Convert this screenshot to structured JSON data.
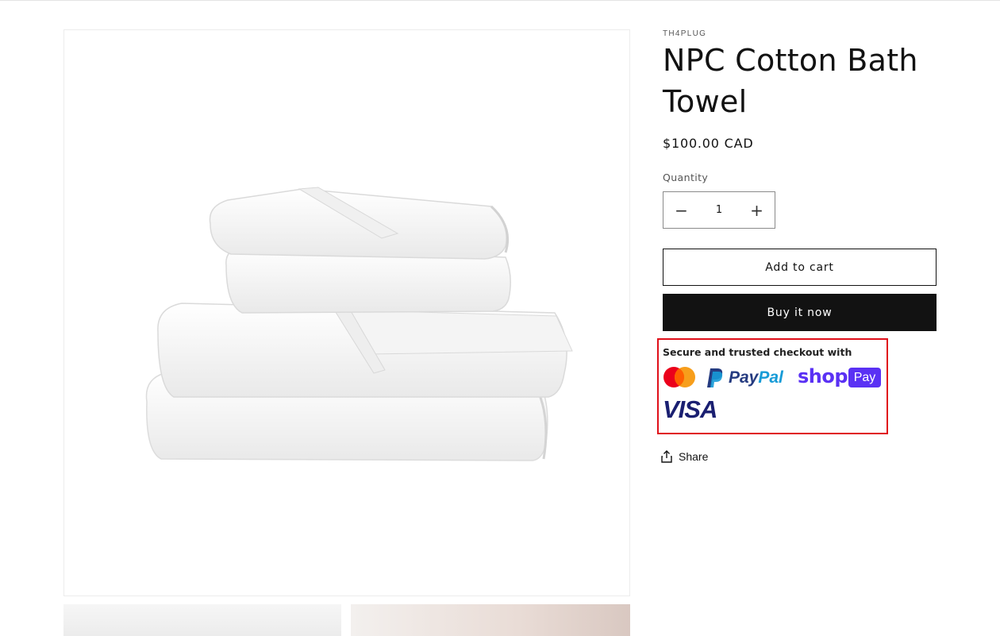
{
  "product": {
    "vendor": "TH4PLUG",
    "title": "NPC Cotton Bath Towel",
    "price": "$100.00 CAD",
    "image_alt": "White cotton bath towels stacked"
  },
  "quantity": {
    "label": "Quantity",
    "value": "1",
    "decrease_symbol": "−",
    "increase_symbol": "+"
  },
  "buttons": {
    "add_to_cart": "Add to cart",
    "buy_now": "Buy it now",
    "share": "Share"
  },
  "trust_badge": {
    "heading": "Secure and trusted checkout with",
    "methods": [
      {
        "name": "Mastercard",
        "icon": "mastercard-icon"
      },
      {
        "name": "PayPal",
        "icon": "paypal-icon",
        "text": "PayPal"
      },
      {
        "name": "Shop Pay",
        "icon": "shop-pay-icon",
        "text_a": "shop",
        "text_b": "Pay"
      },
      {
        "name": "Visa",
        "icon": "visa-icon",
        "text": "VISA"
      }
    ]
  },
  "colors": {
    "accent_dark": "#121212",
    "highlight_border": "#e0101a",
    "paypal_dark": "#253b80",
    "paypal_light": "#179bd7",
    "shop_purple": "#5a31f4",
    "visa_blue": "#1a1f71",
    "mastercard_red": "#eb001b",
    "mastercard_orange": "#f79e1b"
  }
}
